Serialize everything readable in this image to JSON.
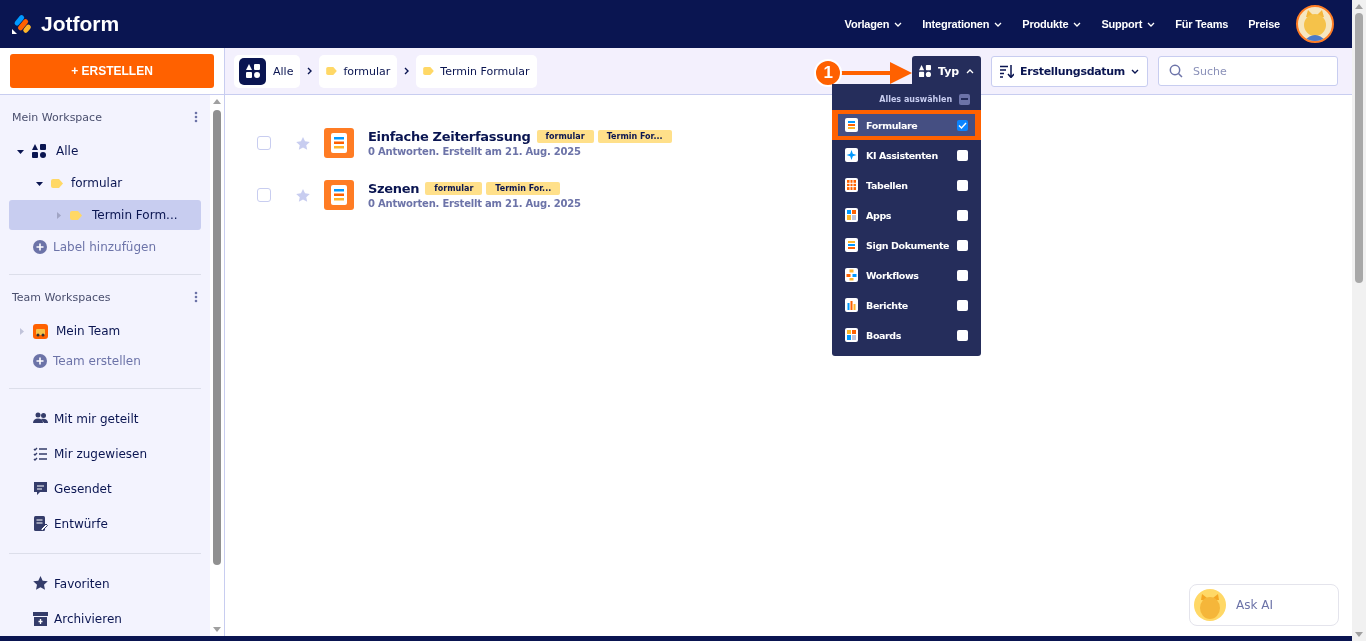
{
  "header": {
    "logo_text": "Jotform",
    "nav": [
      {
        "label": "Vorlagen",
        "dropdown": true
      },
      {
        "label": "Integrationen",
        "dropdown": true
      },
      {
        "label": "Produkte",
        "dropdown": true
      },
      {
        "label": "Support",
        "dropdown": true
      },
      {
        "label": "Für Teams",
        "dropdown": false
      },
      {
        "label": "Preise",
        "dropdown": false
      }
    ]
  },
  "sidebar": {
    "create_button": "+ ERSTELLEN",
    "my_workspace": {
      "title": "Mein Workspace",
      "tree": [
        {
          "label": "Alle",
          "kind": "all",
          "expanded": true,
          "selected": false,
          "children": [
            {
              "label": "formular",
              "kind": "label",
              "expanded": true,
              "selected": false,
              "children": [
                {
                  "label": "Termin Form...",
                  "kind": "label",
                  "expanded": false,
                  "selected": true
                }
              ]
            }
          ]
        }
      ],
      "add_label": "Label hinzufügen"
    },
    "team_workspaces": {
      "title": "Team Workspaces",
      "teams": [
        {
          "label": "Mein Team",
          "expanded": false
        }
      ],
      "create": "Team erstellen"
    },
    "links": [
      {
        "label": "Mit mir geteilt",
        "kind": "shared"
      },
      {
        "label": "Mir zugewiesen",
        "kind": "assigned"
      },
      {
        "label": "Gesendet",
        "kind": "sent"
      },
      {
        "label": "Entwürfe",
        "kind": "drafts"
      }
    ],
    "bottom_links": [
      {
        "label": "Favoriten",
        "kind": "favorites"
      },
      {
        "label": "Archivieren",
        "kind": "archive"
      }
    ]
  },
  "breadcrumb": [
    {
      "label": "Alle",
      "kind": "root"
    },
    {
      "label": "formular",
      "kind": "label"
    },
    {
      "label": "Termin Formular",
      "kind": "label"
    }
  ],
  "toolbar": {
    "annotation": "1",
    "type_filter": {
      "label": "Typ",
      "expanded": true
    },
    "sort": {
      "label": "Erstellungsdatum"
    },
    "search": {
      "placeholder": "Suche"
    }
  },
  "type_menu": {
    "select_all": {
      "label": "Alles auswählen",
      "indeterminate": true
    },
    "options": [
      {
        "label": "Formulare",
        "kind": "forms",
        "checked": true,
        "highlighted": true
      },
      {
        "label": "KI Assistenten",
        "kind": "ai",
        "checked": false,
        "highlighted": false
      },
      {
        "label": "Tabellen",
        "kind": "tables",
        "checked": false,
        "highlighted": false
      },
      {
        "label": "Apps",
        "kind": "apps",
        "checked": false,
        "highlighted": false
      },
      {
        "label": "Sign Dokumente",
        "kind": "sign",
        "checked": false,
        "highlighted": false
      },
      {
        "label": "Workflows",
        "kind": "workflows",
        "checked": false,
        "highlighted": false
      },
      {
        "label": "Berichte",
        "kind": "reports",
        "checked": false,
        "highlighted": false
      },
      {
        "label": "Boards",
        "kind": "boards",
        "checked": false,
        "highlighted": false
      }
    ]
  },
  "forms": [
    {
      "title": "Einfache Zeiterfassung",
      "tags": [
        "formular",
        "Termin For..."
      ],
      "meta": "0 Antworten. Erstellt am 21. Aug. 2025",
      "checked": false,
      "starred": false
    },
    {
      "title": "Szenen",
      "tags": [
        "formular",
        "Termin For..."
      ],
      "meta": "0 Antworten. Erstellt am 21. Aug. 2025",
      "checked": false,
      "starred": false
    }
  ],
  "ask_ai": "Ask AI"
}
